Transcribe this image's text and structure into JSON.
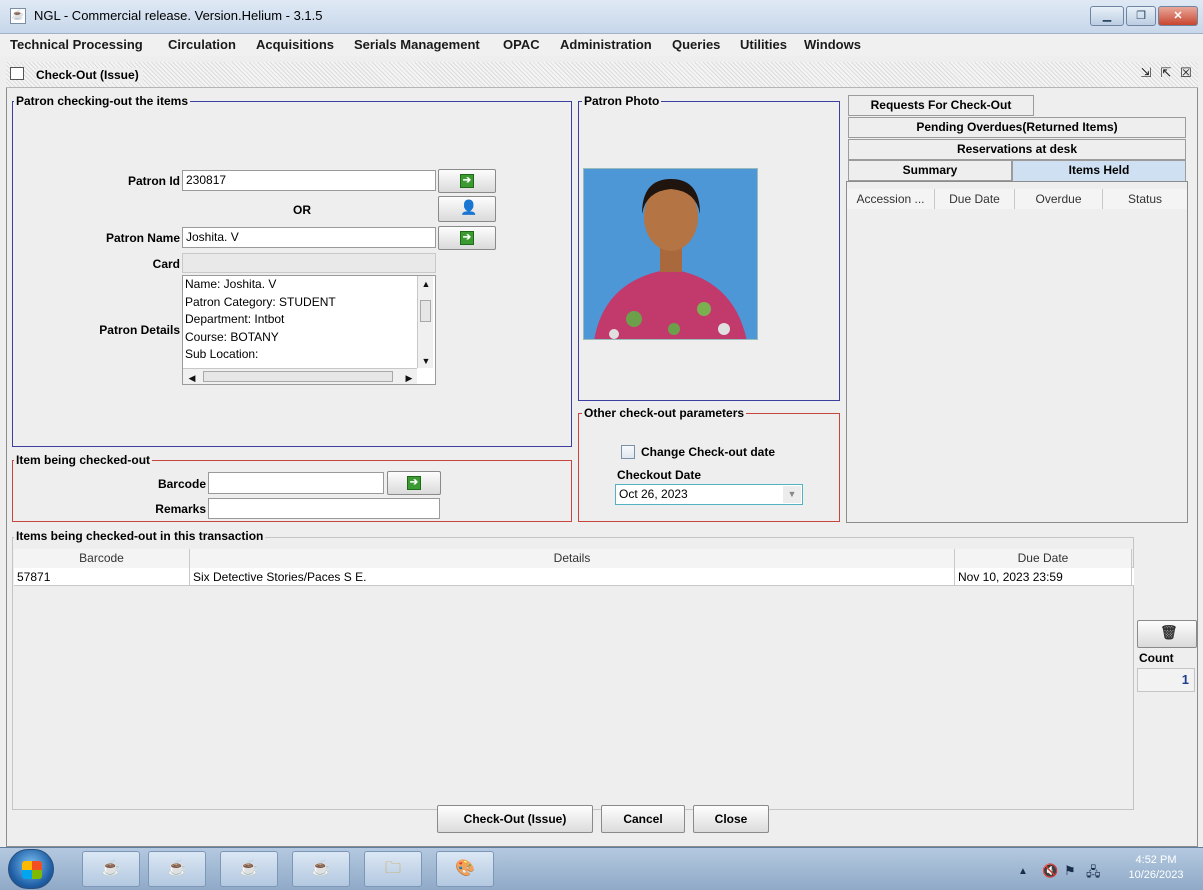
{
  "window": {
    "title": "NGL - Commercial release. Version.Helium - 3.1.5"
  },
  "menu": [
    "Technical Processing",
    "Circulation",
    "Acquisitions",
    "Serials Management",
    "OPAC",
    "Administration",
    "Queries",
    "Utilities",
    "Windows"
  ],
  "frame": {
    "title": "Check-Out (Issue)"
  },
  "patron_group": {
    "title": "Patron checking-out the items",
    "patron_id_label": "Patron Id",
    "patron_id_value": "230817",
    "or_label": "OR",
    "patron_name_label": "Patron Name",
    "patron_name_value": "Joshita. V",
    "card_label": "Card",
    "card_value": "",
    "details_label": "Patron Details",
    "details_lines": [
      "Name: Joshita. V",
      "Patron Category: STUDENT",
      "Department: Intbot",
      "Course: BOTANY",
      "Sub Location:"
    ]
  },
  "photo_group": {
    "title": "Patron Photo"
  },
  "other_params": {
    "title": "Other check-out parameters",
    "change_date_label": "Change Check-out date",
    "change_date_checked": false,
    "checkout_date_label": "Checkout Date",
    "checkout_date_value": "Oct 26, 2023"
  },
  "item_group": {
    "title": "Item being checked-out",
    "barcode_label": "Barcode",
    "barcode_value": "",
    "remarks_label": "Remarks",
    "remarks_value": ""
  },
  "tabs": {
    "row1": [
      "Requests For Check-Out"
    ],
    "row2": [
      "Pending Overdues(Returned Items)"
    ],
    "row3": [
      "Reservations at desk"
    ],
    "row4": [
      "Summary",
      "Items Held"
    ],
    "selected": "Items Held",
    "columns": [
      "Accession ...",
      "Due Date",
      "Overdue",
      "Status"
    ]
  },
  "transaction": {
    "title": "Items being checked-out in this transaction",
    "columns": [
      "Barcode",
      "Details",
      "Due Date"
    ],
    "rows": [
      {
        "barcode": "57871",
        "details": "Six Detective Stories/Paces S E.",
        "due_date": "Nov 10, 2023 23:59"
      }
    ],
    "count_label": "Count",
    "count_value": "1"
  },
  "buttons": {
    "checkout": "Check-Out (Issue)",
    "cancel": "Cancel",
    "close": "Close"
  },
  "taskbar": {
    "time": "4:52 PM",
    "date": "10/26/2023"
  }
}
